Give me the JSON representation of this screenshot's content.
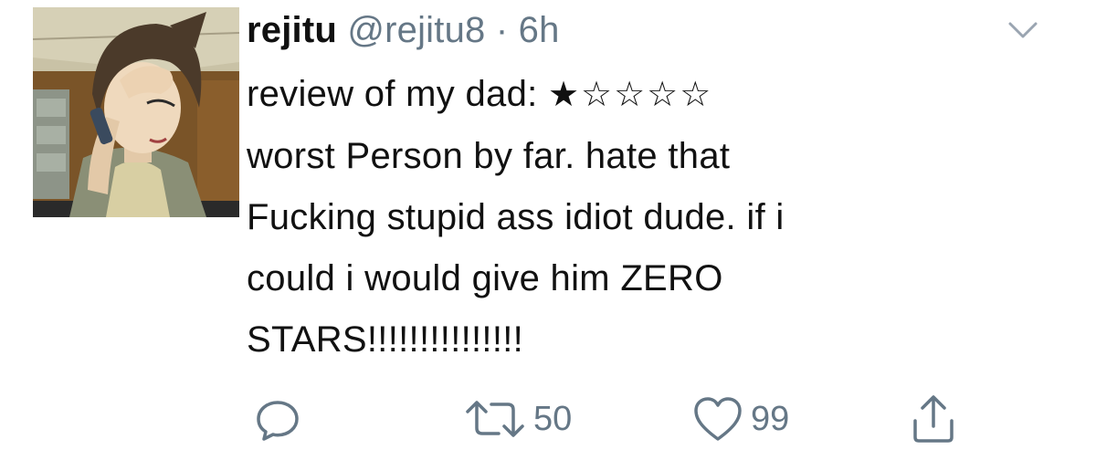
{
  "tweet": {
    "display_name": "rejitu",
    "handle": "@rejitu8",
    "separator": "·",
    "time": "6h",
    "avatar": "anime-character-avatar",
    "lines": [
      "review of my dad: ",
      "worst Person by far. hate that",
      "Fucking stupid ass idiot dude. if i",
      "could i would give him ZERO",
      "STARS!!!!!!!!!!!!!!!"
    ],
    "rating": {
      "stars_text": "★☆☆☆☆",
      "filled": 1,
      "total": 5
    }
  },
  "actions": {
    "reply": {
      "icon": "reply-icon",
      "count": ""
    },
    "retweet": {
      "icon": "retweet-icon",
      "count": "50"
    },
    "like": {
      "icon": "heart-icon",
      "count": "99"
    },
    "share": {
      "icon": "share-icon",
      "count": ""
    }
  },
  "menu": {
    "icon": "chevron-down-icon"
  },
  "colors": {
    "text": "#111111",
    "muted": "#657786",
    "background": "#ffffff"
  }
}
